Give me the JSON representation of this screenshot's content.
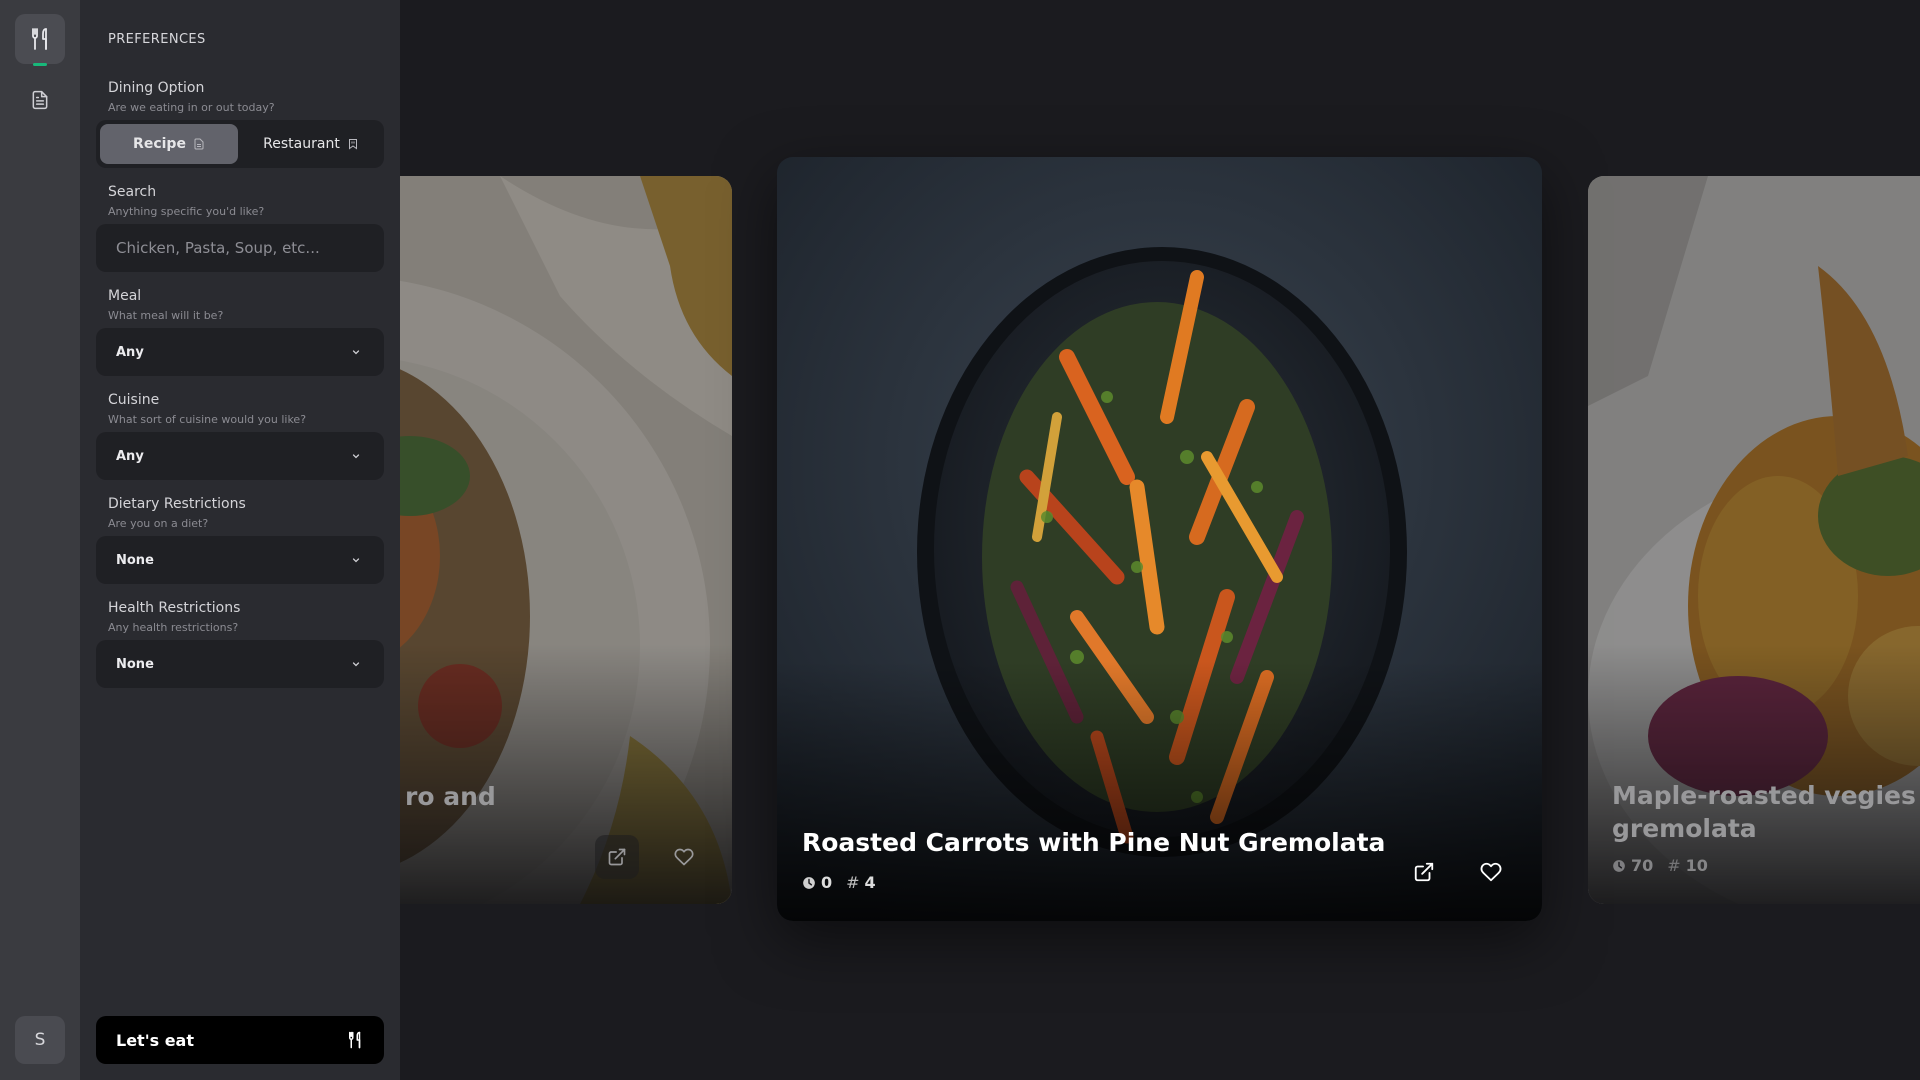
{
  "rail": {
    "items": [
      {
        "icon": "utensils-icon",
        "active": true
      },
      {
        "icon": "document-icon",
        "active": false
      }
    ],
    "avatar_initial": "S"
  },
  "panel": {
    "title": "PREFERENCES",
    "dining": {
      "label": "Dining Option",
      "hint": "Are we eating in or out today?",
      "options": [
        {
          "label": "Recipe",
          "icon": "document-icon",
          "selected": true
        },
        {
          "label": "Restaurant",
          "icon": "bookmark-icon",
          "selected": false
        }
      ]
    },
    "search": {
      "label": "Search",
      "hint": "Anything specific you'd like?",
      "value": "",
      "placeholder": "Chicken, Pasta, Soup, etc..."
    },
    "meal": {
      "label": "Meal",
      "hint": "What meal will it be?",
      "value": "Any"
    },
    "cuisine": {
      "label": "Cuisine",
      "hint": "What sort of cuisine would you like?",
      "value": "Any"
    },
    "dietary": {
      "label": "Dietary Restrictions",
      "hint": "Are you on a diet?",
      "value": "None"
    },
    "health": {
      "label": "Health Restrictions",
      "hint": "Any health restrictions?",
      "value": "None"
    },
    "cta_label": "Let's eat"
  },
  "cards": {
    "left": {
      "title_fragment": "ro and"
    },
    "center": {
      "title": "Roasted Carrots with Pine Nut Gremolata",
      "time": "0",
      "count": "4"
    },
    "right": {
      "title_line1": "Maple-roasted vegies with",
      "title_line2": "gremolata",
      "time": "70",
      "count": "10"
    }
  },
  "colors": {
    "background": "#1b1b1f",
    "rail": "#3a3b40",
    "panel": "#2a2b30",
    "field": "#1f2024",
    "accent": "#18b87a",
    "cta": "#000000"
  }
}
